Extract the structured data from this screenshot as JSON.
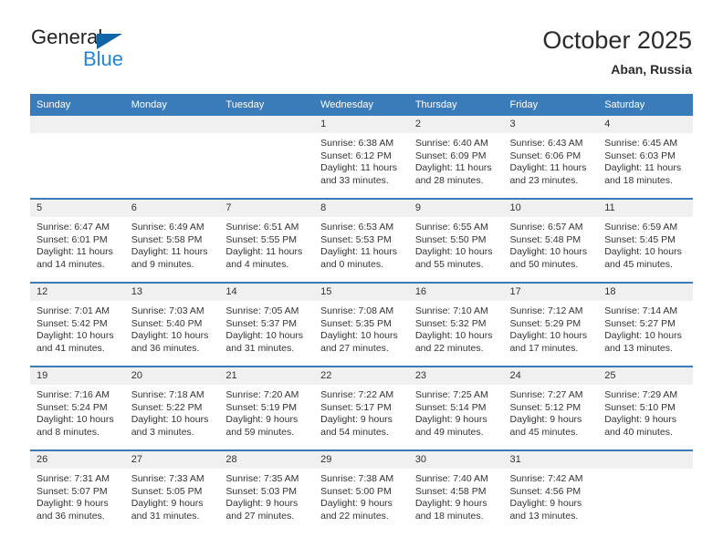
{
  "brand": {
    "word_one": "General",
    "word_two": "Blue",
    "triangle_color": "#1064a8",
    "blue_color": "#2585d3"
  },
  "header": {
    "title": "October 2025",
    "subtitle": "Aban, Russia"
  },
  "theme": {
    "header_blue": "#3a7cba",
    "daynum_band": "#f0f0f0",
    "text": "#333333"
  },
  "weekday_headers": [
    "Sunday",
    "Monday",
    "Tuesday",
    "Wednesday",
    "Thursday",
    "Friday",
    "Saturday"
  ],
  "labels": {
    "sunrise": "Sunrise:",
    "sunset": "Sunset:",
    "daylight": "Daylight:"
  },
  "weeks": [
    [
      {
        "day": "",
        "empty": true
      },
      {
        "day": "",
        "empty": true
      },
      {
        "day": "",
        "empty": true
      },
      {
        "day": "1",
        "sunrise": "Sunrise: 6:38 AM",
        "sunset": "Sunset: 6:12 PM",
        "daylight_line1": "Daylight: 11 hours",
        "daylight_line2": "and 33 minutes."
      },
      {
        "day": "2",
        "sunrise": "Sunrise: 6:40 AM",
        "sunset": "Sunset: 6:09 PM",
        "daylight_line1": "Daylight: 11 hours",
        "daylight_line2": "and 28 minutes."
      },
      {
        "day": "3",
        "sunrise": "Sunrise: 6:43 AM",
        "sunset": "Sunset: 6:06 PM",
        "daylight_line1": "Daylight: 11 hours",
        "daylight_line2": "and 23 minutes."
      },
      {
        "day": "4",
        "sunrise": "Sunrise: 6:45 AM",
        "sunset": "Sunset: 6:03 PM",
        "daylight_line1": "Daylight: 11 hours",
        "daylight_line2": "and 18 minutes."
      }
    ],
    [
      {
        "day": "5",
        "sunrise": "Sunrise: 6:47 AM",
        "sunset": "Sunset: 6:01 PM",
        "daylight_line1": "Daylight: 11 hours",
        "daylight_line2": "and 14 minutes."
      },
      {
        "day": "6",
        "sunrise": "Sunrise: 6:49 AM",
        "sunset": "Sunset: 5:58 PM",
        "daylight_line1": "Daylight: 11 hours",
        "daylight_line2": "and 9 minutes."
      },
      {
        "day": "7",
        "sunrise": "Sunrise: 6:51 AM",
        "sunset": "Sunset: 5:55 PM",
        "daylight_line1": "Daylight: 11 hours",
        "daylight_line2": "and 4 minutes."
      },
      {
        "day": "8",
        "sunrise": "Sunrise: 6:53 AM",
        "sunset": "Sunset: 5:53 PM",
        "daylight_line1": "Daylight: 11 hours",
        "daylight_line2": "and 0 minutes."
      },
      {
        "day": "9",
        "sunrise": "Sunrise: 6:55 AM",
        "sunset": "Sunset: 5:50 PM",
        "daylight_line1": "Daylight: 10 hours",
        "daylight_line2": "and 55 minutes."
      },
      {
        "day": "10",
        "sunrise": "Sunrise: 6:57 AM",
        "sunset": "Sunset: 5:48 PM",
        "daylight_line1": "Daylight: 10 hours",
        "daylight_line2": "and 50 minutes."
      },
      {
        "day": "11",
        "sunrise": "Sunrise: 6:59 AM",
        "sunset": "Sunset: 5:45 PM",
        "daylight_line1": "Daylight: 10 hours",
        "daylight_line2": "and 45 minutes."
      }
    ],
    [
      {
        "day": "12",
        "sunrise": "Sunrise: 7:01 AM",
        "sunset": "Sunset: 5:42 PM",
        "daylight_line1": "Daylight: 10 hours",
        "daylight_line2": "and 41 minutes."
      },
      {
        "day": "13",
        "sunrise": "Sunrise: 7:03 AM",
        "sunset": "Sunset: 5:40 PM",
        "daylight_line1": "Daylight: 10 hours",
        "daylight_line2": "and 36 minutes."
      },
      {
        "day": "14",
        "sunrise": "Sunrise: 7:05 AM",
        "sunset": "Sunset: 5:37 PM",
        "daylight_line1": "Daylight: 10 hours",
        "daylight_line2": "and 31 minutes."
      },
      {
        "day": "15",
        "sunrise": "Sunrise: 7:08 AM",
        "sunset": "Sunset: 5:35 PM",
        "daylight_line1": "Daylight: 10 hours",
        "daylight_line2": "and 27 minutes."
      },
      {
        "day": "16",
        "sunrise": "Sunrise: 7:10 AM",
        "sunset": "Sunset: 5:32 PM",
        "daylight_line1": "Daylight: 10 hours",
        "daylight_line2": "and 22 minutes."
      },
      {
        "day": "17",
        "sunrise": "Sunrise: 7:12 AM",
        "sunset": "Sunset: 5:29 PM",
        "daylight_line1": "Daylight: 10 hours",
        "daylight_line2": "and 17 minutes."
      },
      {
        "day": "18",
        "sunrise": "Sunrise: 7:14 AM",
        "sunset": "Sunset: 5:27 PM",
        "daylight_line1": "Daylight: 10 hours",
        "daylight_line2": "and 13 minutes."
      }
    ],
    [
      {
        "day": "19",
        "sunrise": "Sunrise: 7:16 AM",
        "sunset": "Sunset: 5:24 PM",
        "daylight_line1": "Daylight: 10 hours",
        "daylight_line2": "and 8 minutes."
      },
      {
        "day": "20",
        "sunrise": "Sunrise: 7:18 AM",
        "sunset": "Sunset: 5:22 PM",
        "daylight_line1": "Daylight: 10 hours",
        "daylight_line2": "and 3 minutes."
      },
      {
        "day": "21",
        "sunrise": "Sunrise: 7:20 AM",
        "sunset": "Sunset: 5:19 PM",
        "daylight_line1": "Daylight: 9 hours",
        "daylight_line2": "and 59 minutes."
      },
      {
        "day": "22",
        "sunrise": "Sunrise: 7:22 AM",
        "sunset": "Sunset: 5:17 PM",
        "daylight_line1": "Daylight: 9 hours",
        "daylight_line2": "and 54 minutes."
      },
      {
        "day": "23",
        "sunrise": "Sunrise: 7:25 AM",
        "sunset": "Sunset: 5:14 PM",
        "daylight_line1": "Daylight: 9 hours",
        "daylight_line2": "and 49 minutes."
      },
      {
        "day": "24",
        "sunrise": "Sunrise: 7:27 AM",
        "sunset": "Sunset: 5:12 PM",
        "daylight_line1": "Daylight: 9 hours",
        "daylight_line2": "and 45 minutes."
      },
      {
        "day": "25",
        "sunrise": "Sunrise: 7:29 AM",
        "sunset": "Sunset: 5:10 PM",
        "daylight_line1": "Daylight: 9 hours",
        "daylight_line2": "and 40 minutes."
      }
    ],
    [
      {
        "day": "26",
        "sunrise": "Sunrise: 7:31 AM",
        "sunset": "Sunset: 5:07 PM",
        "daylight_line1": "Daylight: 9 hours",
        "daylight_line2": "and 36 minutes."
      },
      {
        "day": "27",
        "sunrise": "Sunrise: 7:33 AM",
        "sunset": "Sunset: 5:05 PM",
        "daylight_line1": "Daylight: 9 hours",
        "daylight_line2": "and 31 minutes."
      },
      {
        "day": "28",
        "sunrise": "Sunrise: 7:35 AM",
        "sunset": "Sunset: 5:03 PM",
        "daylight_line1": "Daylight: 9 hours",
        "daylight_line2": "and 27 minutes."
      },
      {
        "day": "29",
        "sunrise": "Sunrise: 7:38 AM",
        "sunset": "Sunset: 5:00 PM",
        "daylight_line1": "Daylight: 9 hours",
        "daylight_line2": "and 22 minutes."
      },
      {
        "day": "30",
        "sunrise": "Sunrise: 7:40 AM",
        "sunset": "Sunset: 4:58 PM",
        "daylight_line1": "Daylight: 9 hours",
        "daylight_line2": "and 18 minutes."
      },
      {
        "day": "31",
        "sunrise": "Sunrise: 7:42 AM",
        "sunset": "Sunset: 4:56 PM",
        "daylight_line1": "Daylight: 9 hours",
        "daylight_line2": "and 13 minutes."
      },
      {
        "day": "",
        "empty": true,
        "blank_trailing": true
      }
    ]
  ]
}
